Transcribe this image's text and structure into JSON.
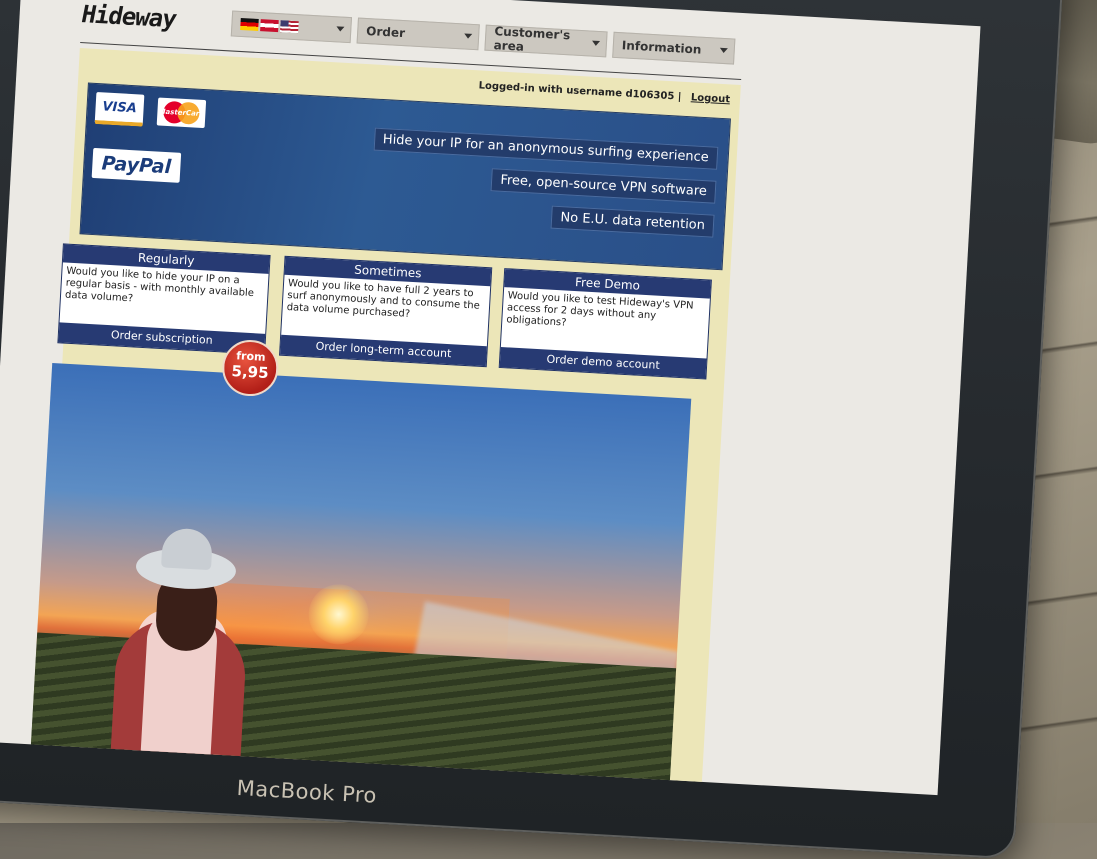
{
  "site": {
    "logo": "Hideway",
    "nav": {
      "order": "Order",
      "customers_area": "Customer's area",
      "information": "Information"
    },
    "login_status": "Logged-in with username d106305",
    "separator": "|",
    "logout": "Logout"
  },
  "hero": {
    "payments": {
      "visa": "VISA",
      "mastercard": "MasterCard",
      "paypal": "PayPal"
    },
    "taglines": [
      "Hide your IP for an anonymous surfing experience",
      "Free, open-source VPN software",
      "No E.U. data retention"
    ]
  },
  "plans": [
    {
      "title": "Regularly",
      "text": "Would you like to hide your IP on a regular basis - with monthly available data volume?",
      "button": "Order subscription"
    },
    {
      "title": "Sometimes",
      "text": "Would you like to have full 2 years to surf anonymously and to consume the data volume purchased?",
      "button": "Order long-term account"
    },
    {
      "title": "Free Demo",
      "text": "Would you like to test Hideway's VPN access for 2 days without any obligations?",
      "button": "Order demo account"
    }
  ],
  "price_badge": {
    "line1": "from",
    "line2": "5,95"
  },
  "device_label": "MacBook Pro",
  "colors": {
    "nav_blue": "#273a73",
    "frame_cream": "#ece6b8",
    "badge_red": "#c02a20"
  }
}
